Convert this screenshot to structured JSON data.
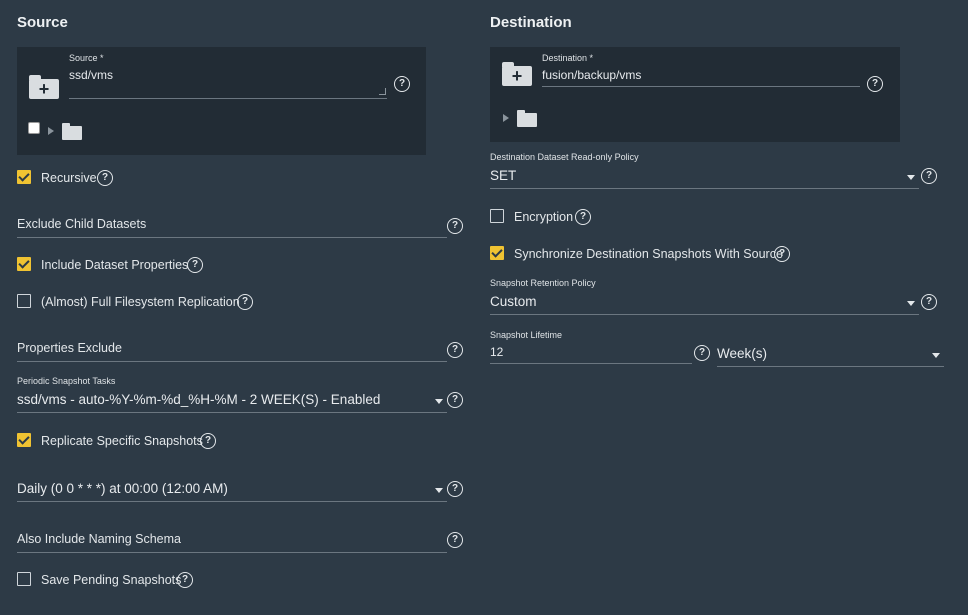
{
  "source": {
    "title": "Source",
    "field_label": "Source *",
    "path": "ssd/vms",
    "recursive_label": "Recursive",
    "exclude_child_label": "Exclude Child Datasets",
    "include_props_label": "Include Dataset Properties",
    "full_fs_label": "(Almost) Full Filesystem Replication",
    "props_exclude_label": "Properties Exclude",
    "periodic_label": "Periodic Snapshot Tasks",
    "periodic_value": "ssd/vms - auto-%Y-%m-%d_%H-%M - 2 WEEK(S) - Enabled",
    "replicate_specific_label": "Replicate Specific Snapshots",
    "schedule_value": "Daily (0 0 * * *) at 00:00 (12:00 AM)",
    "naming_schema_label": "Also Include Naming Schema",
    "save_pending_label": "Save Pending Snapshots"
  },
  "destination": {
    "title": "Destination",
    "field_label": "Destination *",
    "path": "fusion/backup/vms",
    "readonly_policy_label": "Destination Dataset Read-only Policy",
    "readonly_policy_value": "SET",
    "encryption_label": "Encryption",
    "sync_label": "Synchronize Destination Snapshots With Source",
    "retention_label": "Snapshot Retention Policy",
    "retention_value": "Custom",
    "lifetime_label": "Snapshot Lifetime",
    "lifetime_value": "12",
    "lifetime_unit": "Week(s)"
  },
  "help_glyph": "?",
  "colors": {
    "background": "#2d3a46",
    "panel": "#222c35",
    "checkbox_checked": "#f0c332"
  }
}
